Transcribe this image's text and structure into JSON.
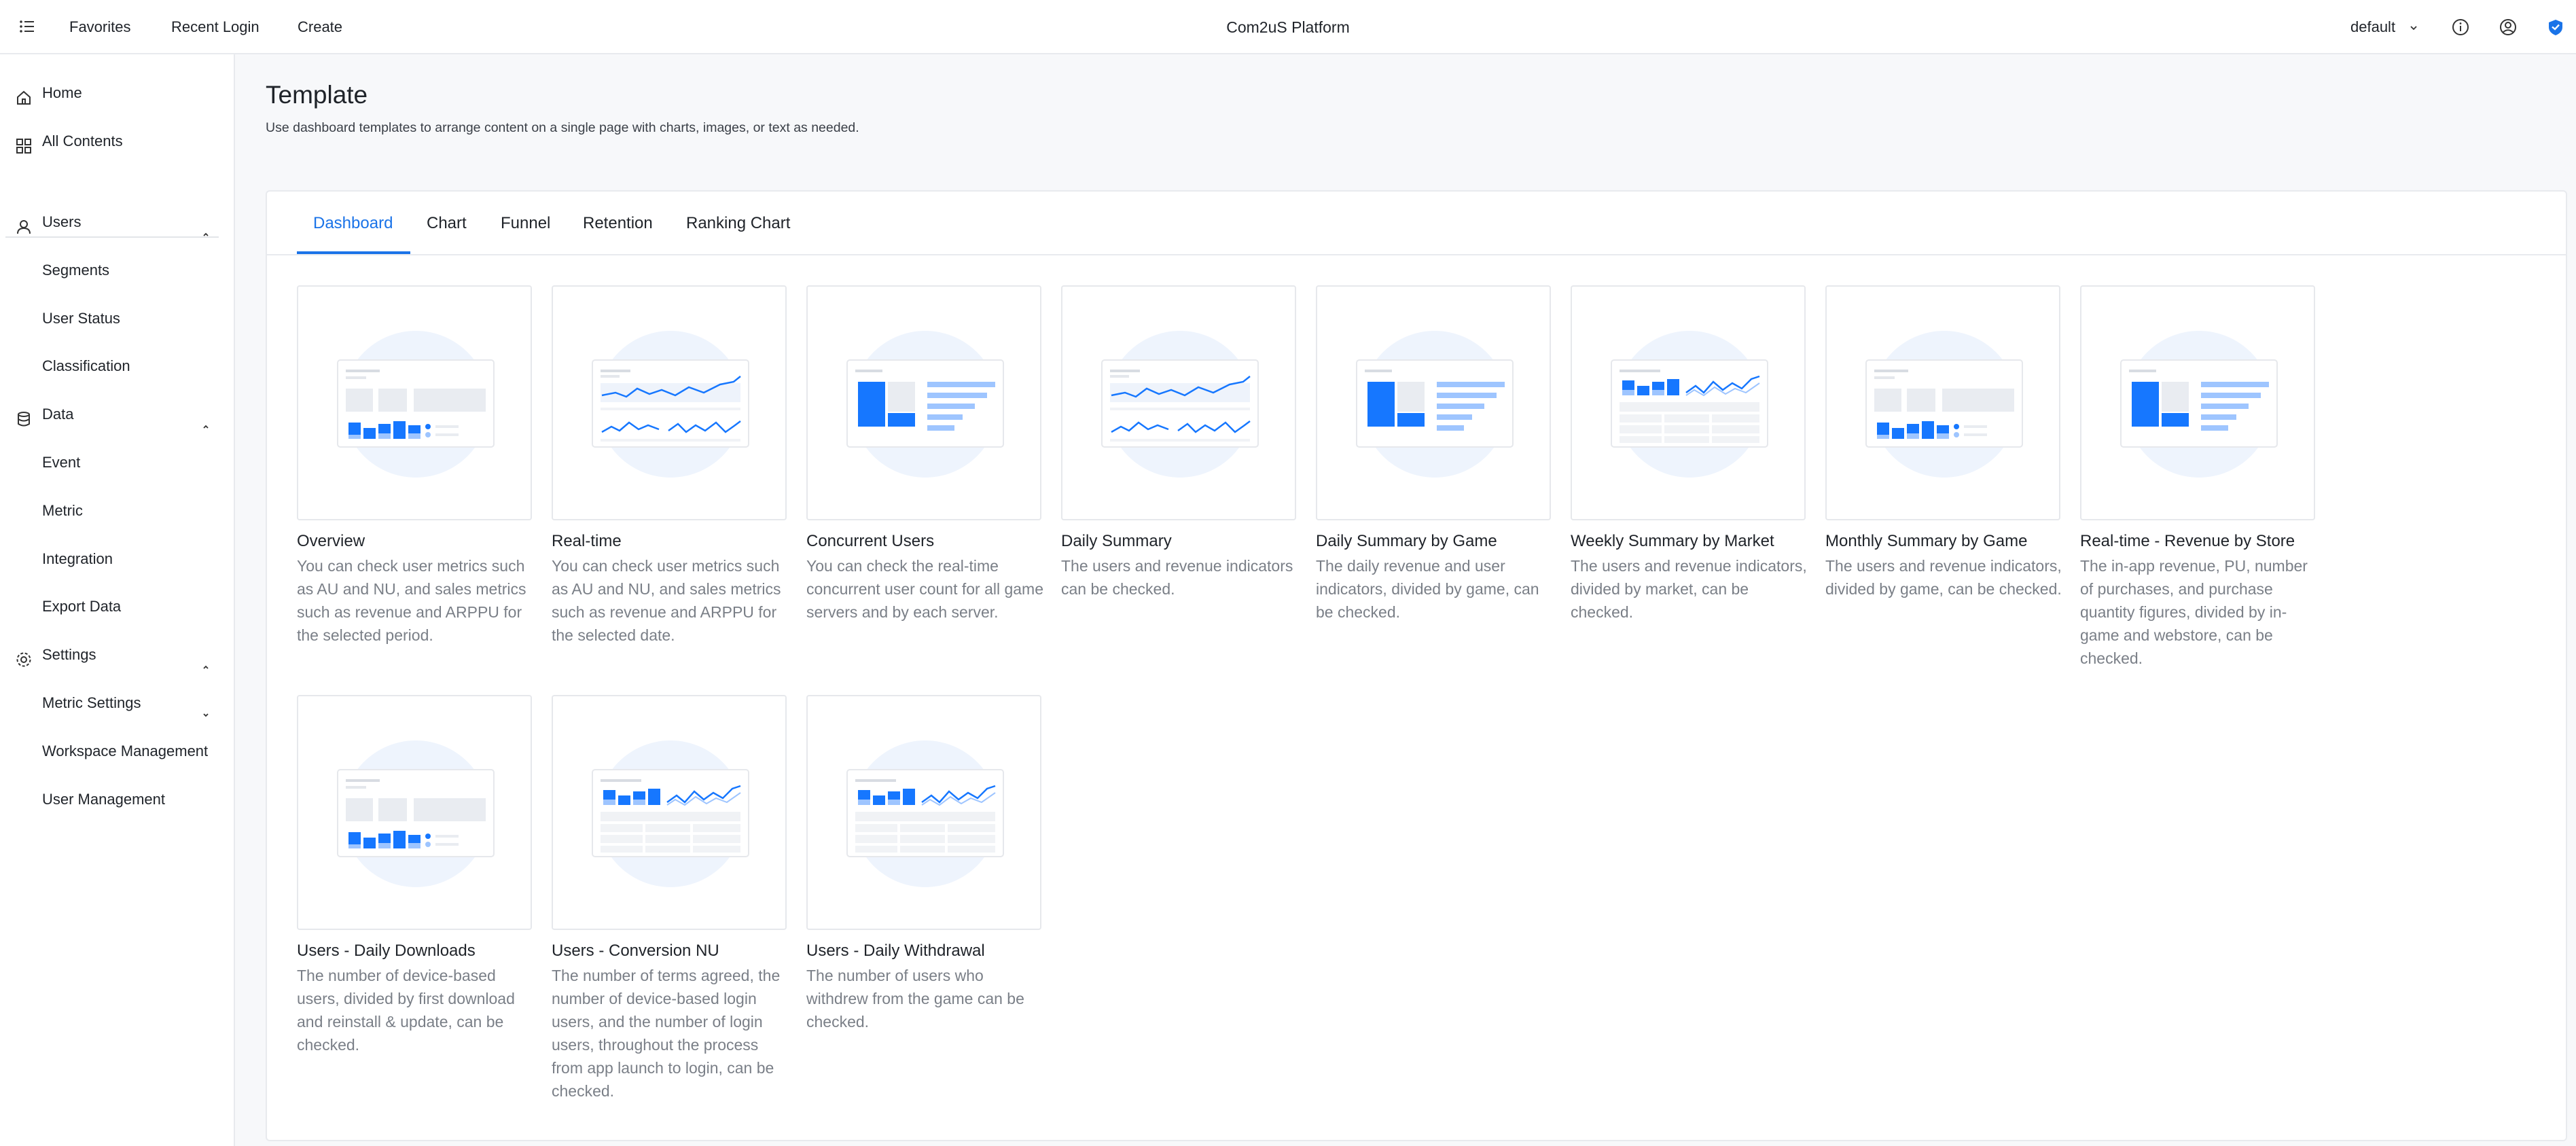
{
  "topbar": {
    "favorites": "Favorites",
    "recent_login": "Recent Login",
    "create": "Create",
    "app_title": "Com2uS Platform",
    "workspace": "default",
    "icons": [
      "menu-icon",
      "info-icon",
      "account-icon",
      "shield-icon"
    ]
  },
  "sidebar": {
    "home": "Home",
    "all_contents": "All Contents",
    "users": "Users",
    "segments": "Segments",
    "user_status": "User Status",
    "classification": "Classification",
    "data": "Data",
    "event": "Event",
    "metric": "Metric",
    "integration": "Integration",
    "export_data": "Export Data",
    "settings": "Settings",
    "metric_settings": "Metric Settings",
    "workspace_management": "Workspace Management",
    "user_management": "User Management"
  },
  "main": {
    "title": "Template",
    "description": "Use dashboard templates to arrange content on a single page with charts, images, or text as needed.",
    "tabs": [
      "Dashboard",
      "Chart",
      "Funnel",
      "Retention",
      "Ranking Chart"
    ],
    "active_tab": "Dashboard"
  },
  "cards": [
    {
      "title": "Overview",
      "desc": "You can check user metrics such as AU and NU, and sales metrics such as revenue and ARPPU for the selected period.",
      "thumb": "overview"
    },
    {
      "title": "Real-time",
      "desc": "You can check user metrics such as AU and NU, and sales metrics such as revenue and ARPPU for the selected date.",
      "thumb": "lines"
    },
    {
      "title": "Concurrent Users",
      "desc": "You can check the real-time concurrent user count for all game servers and by each server.",
      "thumb": "bars-list"
    },
    {
      "title": "Daily Summary",
      "desc": "The users and revenue indicators can be checked.",
      "thumb": "lines"
    },
    {
      "title": "Daily Summary by Game",
      "desc": "The daily revenue and user indicators, divided by game, can be checked.",
      "thumb": "bars-list"
    },
    {
      "title": "Weekly Summary by Market",
      "desc": "The users and revenue indicators, divided by market, can be checked.",
      "thumb": "table"
    },
    {
      "title": "Monthly Summary by Game",
      "desc": "The users and revenue indicators, divided by game, can be checked.",
      "thumb": "overview"
    },
    {
      "title": "Real-time - Revenue by Store",
      "desc": "The in-app revenue, PU, number of purchases, and purchase quantity figures, divided by in-game and webstore, can be checked.",
      "thumb": "bars-list"
    },
    {
      "title": "Users - Daily Downloads",
      "desc": "The number of device-based users, divided by first download and reinstall & update, can be checked.",
      "thumb": "overview"
    },
    {
      "title": "Users - Conversion NU",
      "desc": "The number of terms agreed, the number of device-based login users, and the number of login users, throughout the process from app launch to login, can be checked.",
      "thumb": "table"
    },
    {
      "title": "Users - Daily Withdrawal",
      "desc": "The number of users who withdrew from the game can be checked.",
      "thumb": "table"
    }
  ],
  "colors": {
    "accent": "#1a73e8",
    "bar": "#1677ff",
    "bar_light": "#9ec5ff",
    "circle": "#eef4fd",
    "muted_text": "#7a7f87"
  }
}
